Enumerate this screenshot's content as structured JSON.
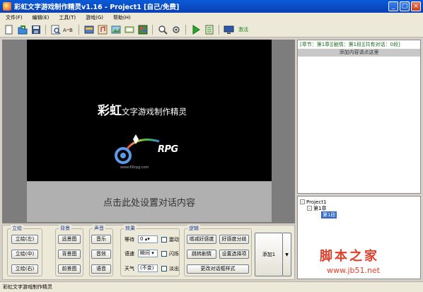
{
  "window": {
    "title": "彩虹文字游戏制作精灵v1.16 - Project1 [自己/免费]",
    "controls": [
      "minimize",
      "maximize",
      "close"
    ]
  },
  "menu": {
    "items": [
      "文件(F)",
      "编辑(E)",
      "工具(T)",
      "游戏(G)",
      "帮助(H)"
    ]
  },
  "toolbar": {
    "icons": [
      "new-file-icon",
      "open-icon",
      "save-icon",
      "search-icon",
      "replace-icon",
      "scene-icon",
      "music-icon",
      "image-icon",
      "window-icon",
      "paint-icon",
      "search-zoom-icon",
      "settings-icon",
      "run-icon",
      "export-icon",
      "monitor-icon"
    ],
    "activate_label": "激活"
  },
  "stage": {
    "logo_main": "彩虹",
    "logo_sub": "文字游戏制作精灵",
    "rpg_text": "RPG",
    "dialog_placeholder": "点击此处设置对话内容"
  },
  "right_panel": {
    "status_line": "[章节：第1章][剧情：第1段][共有对话：0段]",
    "add_content_label": "添加内容请点这里",
    "tree": {
      "root": "Project1",
      "chapter": "第1章",
      "section": "第1段"
    }
  },
  "bottom": {
    "groups": {
      "portrait": {
        "title": "立绘",
        "buttons": [
          "立绘(左)",
          "立绘(中)",
          "立绘(右)"
        ]
      },
      "background": {
        "title": "背景",
        "buttons": [
          "远景图",
          "背景图",
          "前景图"
        ]
      },
      "sound": {
        "title": "声音",
        "buttons": [
          "音乐",
          "音效",
          "语音"
        ]
      },
      "effects": {
        "title": "效果",
        "wait_label": "等待",
        "wait_value": "0",
        "speed_label": "语速",
        "speed_value": "瞬间",
        "weather_label": "天气",
        "weather_value": "(不变)",
        "shake_label": "震动",
        "flash_label": "闪烁",
        "fade_label": "淡出"
      },
      "logic": {
        "title": "逻辑",
        "buttons": [
          "增减好感度",
          "好感度分歧",
          "跳转剧情",
          "设置选择项",
          "更改对话框样式"
        ]
      }
    },
    "add_button": "添加1"
  },
  "statusbar": {
    "text": "彩虹文字游戏制作精灵"
  },
  "watermark": {
    "cn": "脚本之家",
    "url": "www.jb51.net"
  }
}
